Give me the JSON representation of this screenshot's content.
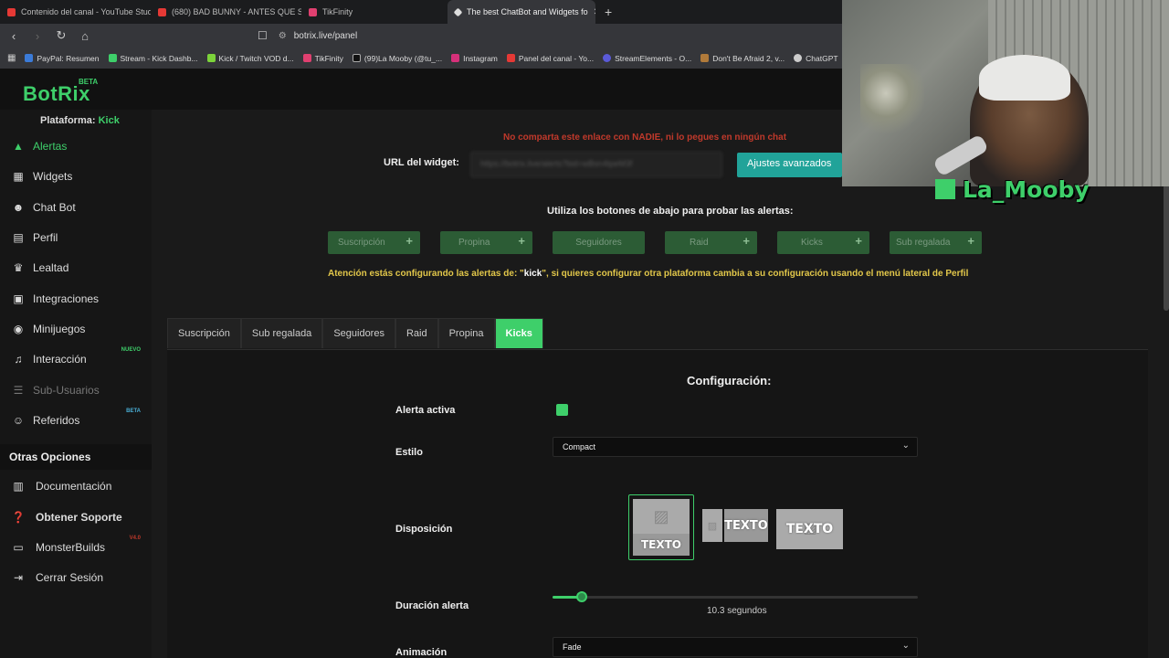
{
  "browser": {
    "tabs": [
      {
        "title": "Contenido del canal - YouTube Studio",
        "active": false
      },
      {
        "title": "(680) BAD BUNNY - ANTES QUE SE A",
        "active": false
      },
      {
        "title": "TikFinity",
        "active": false
      },
      {
        "title": "The best ChatBot and Widgets fo",
        "active": true
      }
    ],
    "url": "botrix.live/panel",
    "bookmarks": [
      "PayPal: Resumen",
      "Stream - Kick Dashb...",
      "Kick / Twitch VOD d...",
      "TikFinity",
      "(99)La Mooby (@tu_...",
      "Instagram",
      "Panel del canal - Yo...",
      "StreamElements - O...",
      "Don't Be Afraid 2, v...",
      "ChatGPT"
    ]
  },
  "brand": {
    "name": "BotRix",
    "badge": "BETA",
    "accent": "#3ecf6a"
  },
  "sidebar": {
    "platform_label": "Plataforma:",
    "platform_value": "Kick",
    "items": [
      {
        "label": "Alertas",
        "icon": "warning-icon"
      },
      {
        "label": "Widgets",
        "icon": "grid-icon"
      },
      {
        "label": "Chat Bot",
        "icon": "robot-icon"
      },
      {
        "label": "Perfil",
        "icon": "id-card-icon"
      },
      {
        "label": "Lealtad",
        "icon": "trophy-icon"
      },
      {
        "label": "Integraciones",
        "icon": "plug-icon"
      },
      {
        "label": "Minijuegos",
        "icon": "gamepad-icon"
      },
      {
        "label": "Interacción",
        "icon": "music-icon",
        "badge": "NUEVO"
      },
      {
        "label": "Sub-Usuarios",
        "icon": "users-icon"
      },
      {
        "label": "Referidos",
        "icon": "user-plus-icon",
        "badge": "BETA"
      }
    ],
    "other_title": "Otras Opciones",
    "other_items": [
      {
        "label": "Documentación",
        "icon": "book-icon"
      },
      {
        "label": "Obtener Soporte",
        "icon": "question-icon"
      },
      {
        "label": "MonsterBuilds",
        "icon": "laptop-icon",
        "badge": "V4.0"
      },
      {
        "label": "Cerrar Sesión",
        "icon": "logout-icon"
      }
    ]
  },
  "main": {
    "warning": "No comparta este enlace con NADIE, ni lo pegues en ningún chat",
    "url_label": "URL del widget:",
    "url_value": "https://botrix.live/alerts?bid=wBsn4tpeM3f",
    "advanced_button": "Ajustes avanzados",
    "test_label": "Utiliza los botones de abajo para probar las alertas:",
    "test_buttons": [
      "Suscripción",
      "Propina",
      "Seguidores",
      "Raid",
      "Kicks",
      "Sub regalada"
    ],
    "notice_pre": "Atención estás configurando las alertas de: \"",
    "notice_platform": "kick",
    "notice_post": "\", si quieres configurar otra plataforma cambia a su configuración usando el menú lateral de Perfil",
    "tabs": [
      "Suscripción",
      "Sub regalada",
      "Seguidores",
      "Raid",
      "Propina",
      "Kicks"
    ],
    "active_tab": "Kicks",
    "config": {
      "title": "Configuración:",
      "alert_active_label": "Alerta activa",
      "alert_active": true,
      "style_label": "Estilo",
      "style_value": "Compact",
      "layout_label": "Disposición",
      "layout_text": "TEXTO",
      "duration_label": "Duración alerta",
      "duration_value": 10.3,
      "duration_max": 130,
      "duration_text": "10.3 segundos",
      "animation_label": "Animación",
      "animation_value": "Fade"
    }
  },
  "webcam": {
    "name": "La_Mooby"
  }
}
